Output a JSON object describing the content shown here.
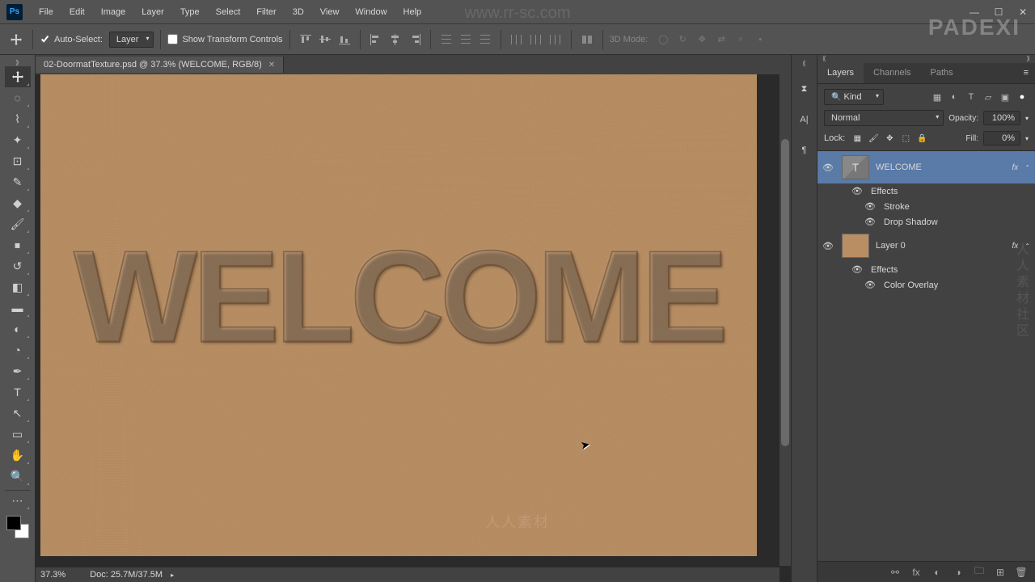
{
  "menubar": {
    "items": [
      "File",
      "Edit",
      "Image",
      "Layer",
      "Type",
      "Select",
      "Filter",
      "3D",
      "View",
      "Window",
      "Help"
    ]
  },
  "options": {
    "auto_select_label": "Auto-Select:",
    "auto_select_target": "Layer",
    "show_transform_label": "Show Transform Controls",
    "mode_3d_label": "3D Mode:"
  },
  "document": {
    "tab_title": "02-DoormatTexture.psd @ 37.3% (WELCOME, RGB/8)",
    "canvas_text": "WELCOME"
  },
  "statusbar": {
    "zoom": "37.3%",
    "doc_info": "Doc: 25.7M/37.5M"
  },
  "panels": {
    "tabs": [
      "Layers",
      "Channels",
      "Paths"
    ],
    "filter_kind": "Kind",
    "blend_mode": "Normal",
    "opacity_label": "Opacity:",
    "opacity_value": "100%",
    "lock_label": "Lock:",
    "fill_label": "Fill:",
    "fill_value": "0%"
  },
  "layers": [
    {
      "name": "WELCOME",
      "type": "text",
      "fx": "fx",
      "effects_label": "Effects",
      "effects": [
        "Stroke",
        "Drop Shadow"
      ]
    },
    {
      "name": "Layer 0",
      "type": "raster",
      "fx": "fx",
      "effects_label": "Effects",
      "effects": [
        "Color Overlay"
      ]
    }
  ],
  "watermarks": {
    "url": "www.rr-sc.com",
    "brand": "PADEXI",
    "center_cn": "人人素材",
    "side_cn": "人人素材社区"
  }
}
